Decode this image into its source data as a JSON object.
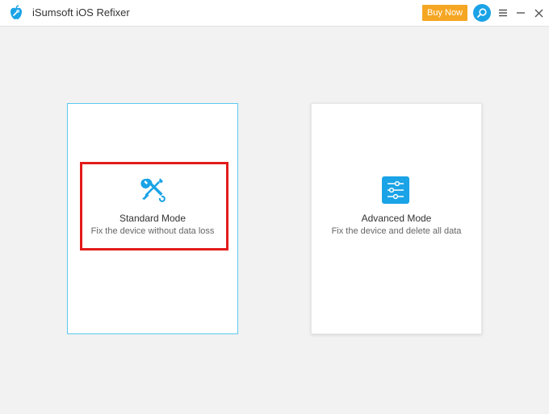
{
  "app": {
    "title": "iSumsoft iOS Refixer",
    "buy_label": "Buy Now"
  },
  "colors": {
    "accent": "#1aa3e6",
    "buy": "#f5a623",
    "highlight": "#e31b1b"
  },
  "modes": [
    {
      "title": "Standard Mode",
      "description": "Fix the device without data loss",
      "icon": "tools-icon",
      "selected": true
    },
    {
      "title": "Advanced Mode",
      "description": "Fix the device and delete all data",
      "icon": "sliders-icon",
      "selected": false
    }
  ]
}
